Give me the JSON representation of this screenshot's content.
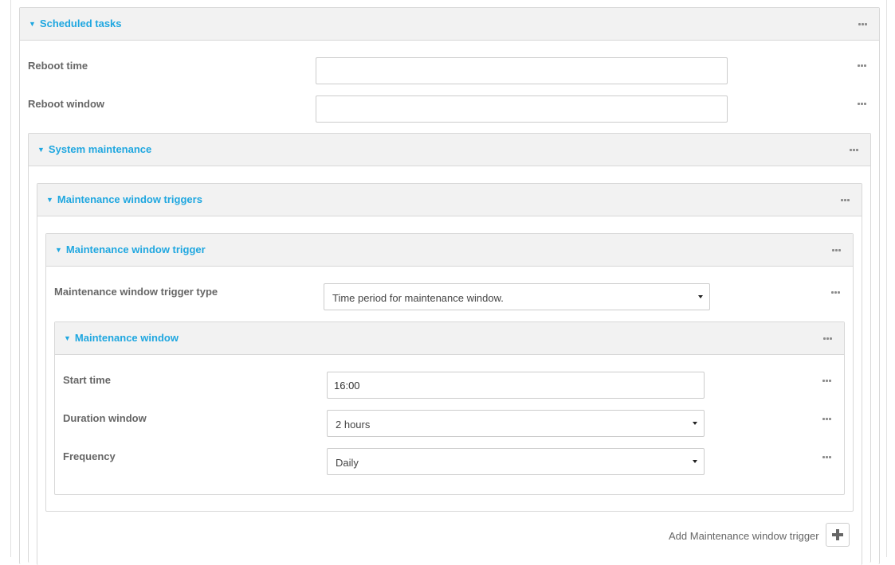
{
  "scheduled_tasks": {
    "title": "Scheduled tasks",
    "reboot_time": {
      "label": "Reboot time",
      "value": ""
    },
    "reboot_window": {
      "label": "Reboot window",
      "value": ""
    }
  },
  "system_maintenance": {
    "title": "System maintenance",
    "triggers": {
      "title": "Maintenance window triggers",
      "trigger": {
        "title": "Maintenance window trigger",
        "type": {
          "label": "Maintenance window trigger type",
          "selected": "Time period for maintenance window."
        },
        "window": {
          "title": "Maintenance window",
          "start_time": {
            "label": "Start time",
            "value": "16:00"
          },
          "duration": {
            "label": "Duration window",
            "selected": "2 hours"
          },
          "frequency": {
            "label": "Frequency",
            "selected": "Daily"
          }
        }
      },
      "add_trigger_label": "Add Maintenance window trigger"
    }
  },
  "icons": {
    "collapse": "caret-down-icon",
    "more": "more-horizontal-icon",
    "add": "plus-icon"
  },
  "colors": {
    "accent": "#1fa7e0",
    "header_bg": "#f2f2f2",
    "border": "#d8d8d8"
  }
}
